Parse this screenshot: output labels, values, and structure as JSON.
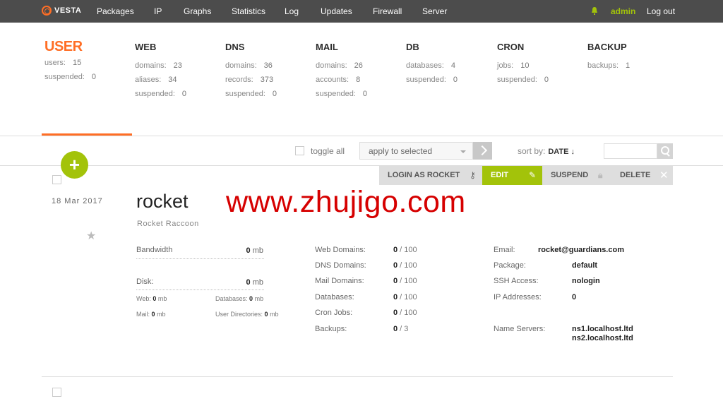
{
  "nav": {
    "logo": "VESTA",
    "items": [
      "Packages",
      "IP",
      "Graphs",
      "Statistics",
      "Log",
      "Updates",
      "Firewall",
      "Server"
    ],
    "user": "admin",
    "logout": "Log out"
  },
  "stats": [
    {
      "title": "USER",
      "rows": [
        {
          "k": "users:",
          "v": "15"
        },
        {
          "k": "suspended:",
          "v": "0"
        }
      ]
    },
    {
      "title": "WEB",
      "rows": [
        {
          "k": "domains:",
          "v": "23"
        },
        {
          "k": "aliases:",
          "v": "34"
        },
        {
          "k": "suspended:",
          "v": "0"
        }
      ]
    },
    {
      "title": "DNS",
      "rows": [
        {
          "k": "domains:",
          "v": "36"
        },
        {
          "k": "records:",
          "v": "373"
        },
        {
          "k": "suspended:",
          "v": "0"
        }
      ]
    },
    {
      "title": "MAIL",
      "rows": [
        {
          "k": "domains:",
          "v": "26"
        },
        {
          "k": "accounts:",
          "v": "8"
        },
        {
          "k": "suspended:",
          "v": "0"
        }
      ]
    },
    {
      "title": "DB",
      "rows": [
        {
          "k": "databases:",
          "v": "4"
        },
        {
          "k": "suspended:",
          "v": "0"
        }
      ]
    },
    {
      "title": "CRON",
      "rows": [
        {
          "k": "jobs:",
          "v": "10"
        },
        {
          "k": "suspended:",
          "v": "0"
        }
      ]
    },
    {
      "title": "BACKUP",
      "rows": [
        {
          "k": "backups:",
          "v": "1"
        }
      ]
    }
  ],
  "toolbar": {
    "toggle_all": "toggle all",
    "apply_select": "apply to selected",
    "sort_label": "sort by:",
    "sort_value": "DATE ↓"
  },
  "add_button": "+",
  "actions": {
    "login_as": "LOGIN AS ROCKET",
    "edit": "EDIT",
    "suspend": "SUSPEND",
    "delete": "DELETE"
  },
  "user": {
    "date": "18 Mar 2017",
    "name": "rocket",
    "full_name": "Rocket Raccoon",
    "bandwidth_label": "Bandwidth",
    "bandwidth_value": "0",
    "disk_label": "Disk:",
    "disk_value": "0",
    "unit": "mb",
    "disk_web_label": "Web:",
    "disk_web": "0",
    "disk_db_label": "Databases:",
    "disk_db": "0",
    "disk_mail_label": "Mail:",
    "disk_mail": "0",
    "disk_udir_label": "User Directories:",
    "disk_udir": "0",
    "limits": [
      {
        "k": "Web Domains:",
        "used": "0",
        "total": "100"
      },
      {
        "k": "DNS Domains:",
        "used": "0",
        "total": "100"
      },
      {
        "k": "Mail Domains:",
        "used": "0",
        "total": "100"
      },
      {
        "k": "Databases:",
        "used": "0",
        "total": "100"
      },
      {
        "k": "Cron Jobs:",
        "used": "0",
        "total": "100"
      },
      {
        "k": "Backups:",
        "used": "0",
        "total": "3"
      }
    ],
    "email_label": "Email:",
    "email": "rocket@guardians.com",
    "package_label": "Package:",
    "package": "default",
    "ssh_label": "SSH Access:",
    "ssh": "nologin",
    "ip_label": "IP Addresses:",
    "ip": "0",
    "ns_label": "Name Servers:",
    "ns1": "ns1.localhost.ltd",
    "ns2": "ns2.localhost.ltd"
  },
  "watermark": "www.zhujigo.com",
  "icons": {
    "lock": "lock-icon",
    "pencil": "pencil-icon",
    "key": "key-icon",
    "close": "close-icon"
  }
}
